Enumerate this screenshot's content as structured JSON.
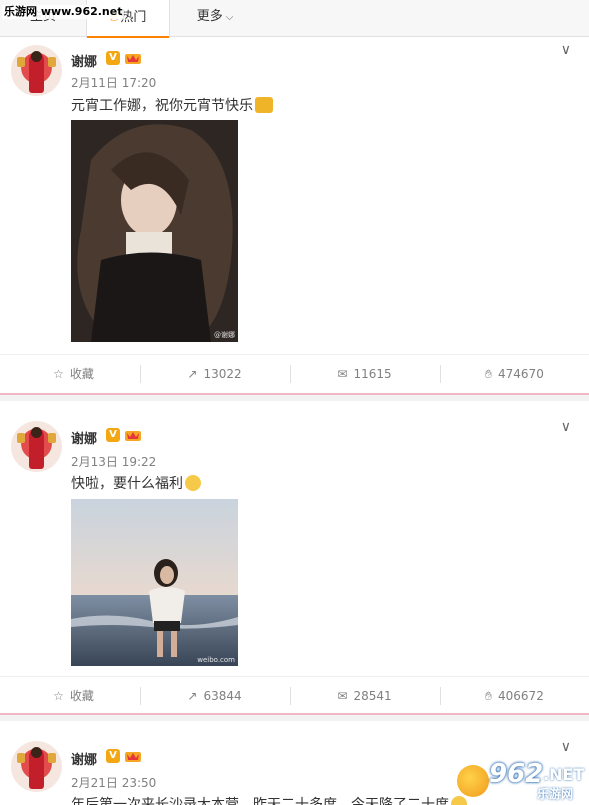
{
  "site_watermark": "乐游网 www.962.net",
  "tabs": {
    "home": "主页",
    "hot": "热门",
    "more": "更多"
  },
  "colors": {
    "accent": "#ff8200",
    "divider_pink": "#f2b7c4",
    "vip_gold": "#f3a712"
  },
  "posts": [
    {
      "author": "谢娜",
      "verified_icon": "v-badge-icon",
      "member_icon": "crown-icon",
      "time": "2月11日 17:20",
      "text": "元宵工作娜，祝你元宵节快乐",
      "emoji": "beer-icon",
      "image_mark": "@谢娜",
      "actions": {
        "favorite": "收藏",
        "repost": "13022",
        "comment": "11615",
        "like": "474670"
      }
    },
    {
      "author": "谢娜",
      "verified_icon": "v-badge-icon",
      "member_icon": "crown-icon",
      "time": "2月13日 19:22",
      "text": "快啦，要什么福利",
      "emoji": "smile-icon",
      "image_mark": "weibo.com",
      "actions": {
        "favorite": "收藏",
        "repost": "63844",
        "comment": "28541",
        "like": "406672"
      }
    },
    {
      "author": "谢娜",
      "verified_icon": "v-badge-icon",
      "member_icon": "crown-icon",
      "time": "2月21日 23:50",
      "text": "年后第一次来长沙录大本营，昨天二十多度，今天降了二十度",
      "emoji": "smile-icon"
    }
  ],
  "corner_watermark": {
    "num": "962",
    "net": ".NET",
    "cn": "乐游网"
  }
}
